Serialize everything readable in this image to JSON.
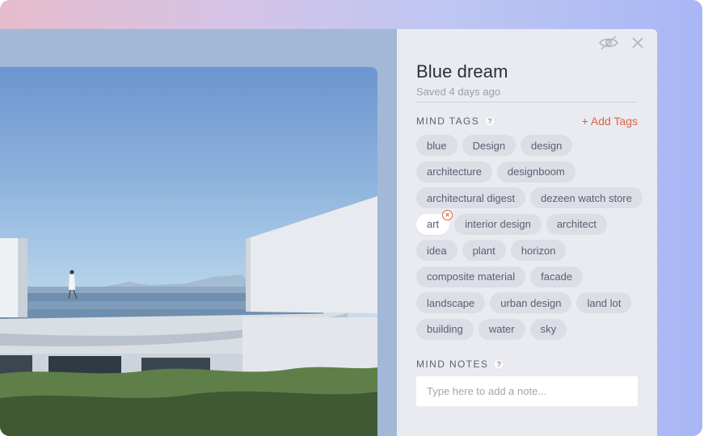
{
  "card": {
    "title": "Blue dream",
    "saved": "Saved 4 days ago"
  },
  "icons": {
    "hide": "eye-off-icon",
    "close": "close-icon"
  },
  "colors": {
    "accent": "#e0603f",
    "panel_bg": "#eaebf1",
    "tag_bg": "#dcdee6"
  },
  "mind_tags": {
    "label": "MIND TAGS",
    "help": "?",
    "add_label": "+ Add Tags",
    "tags": [
      "blue",
      "Design",
      "design",
      "architecture",
      "designboom",
      "architectural digest",
      "dezeen watch store",
      "art",
      "interior design",
      "architect",
      "idea",
      "plant",
      "horizon",
      "composite material",
      "facade",
      "landscape",
      "urban design",
      "land lot",
      "building",
      "water",
      "sky"
    ],
    "active_tag": "art"
  },
  "mind_notes": {
    "label": "MIND NOTES",
    "help": "?",
    "placeholder": "Type here to add a note..."
  },
  "image": {
    "subject": "architecture-photo"
  }
}
